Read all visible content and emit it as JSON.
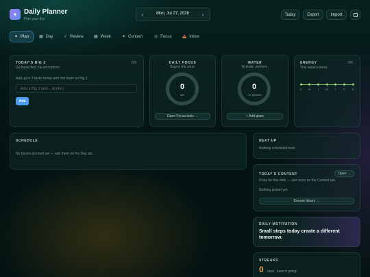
{
  "header": {
    "title": "Daily Planner",
    "subtitle": "Plan your day",
    "date": "Mon, Jul 27, 2026",
    "prev": "‹",
    "next": "›",
    "today": "Today",
    "export": "Export",
    "import": "Import"
  },
  "tabs": [
    {
      "label": "Plan",
      "icon": "✦"
    },
    {
      "label": "Day",
      "icon": "▦"
    },
    {
      "label": "Review",
      "icon": "✓"
    },
    {
      "label": "Week",
      "icon": "▦"
    },
    {
      "label": "Content",
      "icon": "✦"
    },
    {
      "label": "Focus",
      "icon": "◎"
    },
    {
      "label": "Inbox",
      "icon": "📥"
    }
  ],
  "big3": {
    "title": "TODAY'S BIG 3",
    "subtitle": "Do these first. No exceptions.",
    "count": "0/3",
    "hint": "Add up to 3 tasks below and star them as Big 3.",
    "placeholder": "Add a Big 3 task... (Enter)",
    "add": "Add"
  },
  "focus": {
    "title": "DAILY FOCUS",
    "subtitle": "Stay in the zone.",
    "value": "0",
    "unit": "min",
    "button": "Open Focus tools →"
  },
  "water": {
    "title": "WATER",
    "subtitle": "Hydrate, perform.",
    "value": "0",
    "unit": "/ 10 glasses",
    "button": "+ Add glass"
  },
  "energy": {
    "title": "ENERGY",
    "subtitle": "This week's trend.",
    "percent": "0%",
    "days": [
      "S",
      "M",
      "T",
      "W",
      "T",
      "F",
      "S"
    ],
    "levels": [
      0,
      0,
      0,
      0,
      0,
      0,
      0
    ]
  },
  "schedule": {
    "title": "SCHEDULE",
    "empty": "No blocks planned yet — add them on the Day tab."
  },
  "next_up": {
    "title": "NEXT UP",
    "empty": "Nothing scheduled next."
  },
  "content": {
    "title": "TODAY'S CONTENT",
    "open": "Open →",
    "hint": "Picks for this date — star more on the Content tab.",
    "empty": "Nothing picked yet.",
    "browse": "Browse library →"
  },
  "motivation": {
    "title": "DAILY MOTIVATION",
    "quote": "Small steps today create a different tomorrow."
  },
  "streaks": {
    "title": "STREAKS",
    "value": "0",
    "unit": "days",
    "note": "keep it going!"
  },
  "colors": {
    "accent_blue": "#4c9ff5",
    "logo_purple": "#8b74f0",
    "energy_green": "#9ad86f",
    "streak_orange": "#f0a640"
  }
}
